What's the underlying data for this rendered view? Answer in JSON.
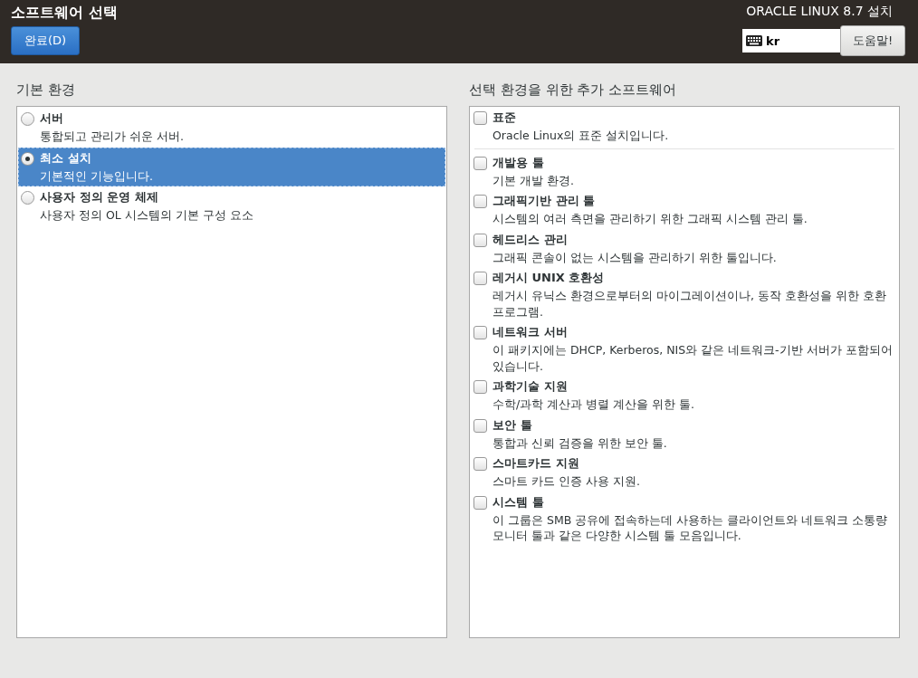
{
  "header": {
    "title": "소프트웨어 선택",
    "done_button": "완료(D)",
    "product": "ORACLE LINUX 8.7 설치",
    "keyboard": {
      "value": "kr"
    },
    "help_button": "도움말!"
  },
  "base_environment": {
    "heading": "기본 환경",
    "items": [
      {
        "name": "서버",
        "description": "통합되고 관리가 쉬운 서버.",
        "selected": false
      },
      {
        "name": "최소 설치",
        "description": "기본적인 기능입니다.",
        "selected": true
      },
      {
        "name": "사용자 정의 운영 체제",
        "description": "사용자 정의 OL 시스템의 기본 구성 요소",
        "selected": false
      }
    ]
  },
  "additional_software": {
    "heading": "선택 환경을 위한 추가 소프트웨어",
    "environment_addons": [
      {
        "name": "표준",
        "description": "Oracle Linux의 표준 설치입니다.",
        "checked": false
      }
    ],
    "common_addons": [
      {
        "name": "개발용 툴",
        "description": "기본 개발 환경.",
        "checked": false
      },
      {
        "name": "그래픽기반 관리 툴",
        "description": "시스템의 여러 측면을 관리하기 위한 그래픽 시스템 관리 툴.",
        "checked": false
      },
      {
        "name": "헤드리스 관리",
        "description": "그래픽 콘솔이 없는 시스템을 관리하기 위한 툴입니다.",
        "checked": false
      },
      {
        "name": "레거시 UNIX 호환성",
        "description": "레거시 유닉스 환경으로부터의 마이그레이션이나, 동작 호환성을 위한 호환 프로그램.",
        "checked": false
      },
      {
        "name": "네트워크 서버",
        "description": "이 패키지에는 DHCP, Kerberos, NIS와 같은 네트워크-기반 서버가 포함되어 있습니다.",
        "checked": false
      },
      {
        "name": "과학기술 지원",
        "description": "수학/과학 계산과 병렬 계산을 위한 툴.",
        "checked": false
      },
      {
        "name": "보안 툴",
        "description": "통합과 신뢰 검증을 위한 보안 툴.",
        "checked": false
      },
      {
        "name": "스마트카드 지원",
        "description": "스마트 카드 인증 사용 지원.",
        "checked": false
      },
      {
        "name": "시스템 툴",
        "description": "이 그룹은 SMB 공유에 접속하는데 사용하는 클라이언트와 네트워크 소통량모니터 툴과 같은 다양한 시스템 툴 모음입니다.",
        "checked": false
      }
    ]
  }
}
